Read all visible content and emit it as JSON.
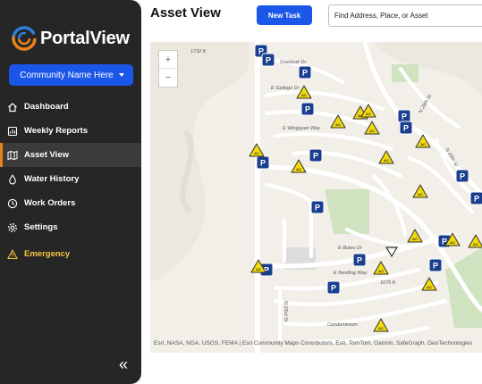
{
  "app": {
    "brand": "PortalView",
    "logo_icon": "portalview-logo-icon"
  },
  "community_select": {
    "label": "Community Name Here"
  },
  "nav": {
    "items": [
      {
        "label": "Dashboard",
        "icon": "home-icon"
      },
      {
        "label": "Weekly Reports",
        "icon": "reports-icon"
      },
      {
        "label": "Asset View",
        "icon": "map-icon",
        "active": true
      },
      {
        "label": "Water History",
        "icon": "water-drop-icon"
      },
      {
        "label": "Work Orders",
        "icon": "clock-icon"
      },
      {
        "label": "Settings",
        "icon": "gear-icon"
      },
      {
        "label": "Emergency",
        "icon": "warning-icon",
        "color": "#f5c542"
      }
    ],
    "collapse_label": "«"
  },
  "header": {
    "title": "Asset View",
    "new_task_label": "New Task",
    "search_placeholder": "Find Address, Place, or Asset"
  },
  "map": {
    "zoom_in": "+",
    "zoom_out": "−",
    "street_labels": [
      "Overlook Dr",
      "E Gallego Dr",
      "E Wingspan Way",
      "E Buteo Dr",
      "E Nestling Way",
      "Condominium",
      "N 28th St",
      "N 23rd St",
      "N 28th St"
    ],
    "elevation_labels": [
      "1732 ft",
      "1675 ft"
    ],
    "attribution": "Esri, NASA, NGA, USGS, FEMA | Esri Community Maps Contributors, Esri, TomTom, Garmin, SafeGraph, GeoTechnologies",
    "marker_types": {
      "parking": "P",
      "ac": "AC"
    },
    "colors": {
      "parking_fill": "#1a3f8f",
      "ac_fill": "#f2d90a",
      "road": "#ffffff",
      "park": "#cfe3c1"
    }
  }
}
